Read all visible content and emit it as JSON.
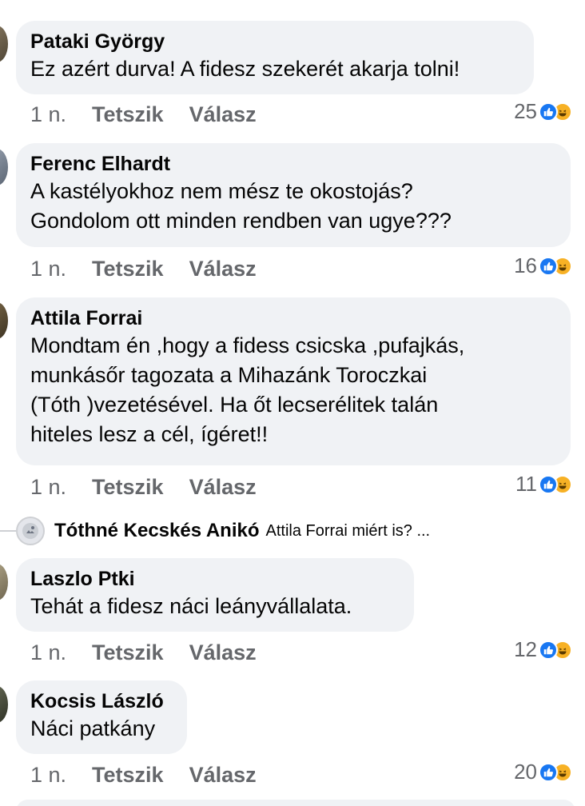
{
  "comments": [
    {
      "author": "Pataki György",
      "text": [
        "Ez azért durva! A fidesz szekerét akarja tolni!"
      ],
      "time": "1 n.",
      "like_label": "Tetszik",
      "reply_label": "Válasz",
      "reaction_count": "25",
      "reactions": [
        "like-icon",
        "haha-icon"
      ]
    },
    {
      "author": "Ferenc Elhardt",
      "text": [
        "A kastélyokhoz nem mész te okostojás?",
        "Gondolom ott minden rendben van ugye???"
      ],
      "time": "1 n.",
      "like_label": "Tetszik",
      "reply_label": "Válasz",
      "reaction_count": "16",
      "reactions": [
        "like-icon",
        "haha-icon"
      ]
    },
    {
      "author": "Attila Forrai",
      "text": [
        "Mondtam én ,hogy a fidess csicska ,pufajkás,",
        "munkásőr tagozata a Mihazánk Toroczkai",
        "(Tóth )vezetésével. Ha őt lecserélitek talán",
        "hiteles lesz a cél, ígéret!!"
      ],
      "time": "1 n.",
      "like_label": "Tetszik",
      "reply_label": "Válasz",
      "reaction_count": "11",
      "reactions": [
        "like-icon",
        "haha-icon"
      ],
      "reply_preview": {
        "author": "Tóthné Kecskés Anikó",
        "snippet": "Attila Forrai  miért is? ..."
      }
    },
    {
      "author": "Laszlo Ptki",
      "text": [
        "Tehát a fidesz náci leányvállalata."
      ],
      "time": "1 n.",
      "like_label": "Tetszik",
      "reply_label": "Válasz",
      "reaction_count": "12",
      "reactions": [
        "like-icon",
        "haha-icon"
      ]
    },
    {
      "author": "Kocsis László",
      "text": [
        "Náci patkány"
      ],
      "time": "1 n.",
      "like_label": "Tetszik",
      "reply_label": "Válasz",
      "reaction_count": "20",
      "reactions": [
        "like-icon",
        "haha-icon"
      ]
    }
  ],
  "colors": {
    "bubble_bg": "#f0f2f5",
    "secondary_text": "#65676b",
    "like_blue": "#1877f2",
    "haha_yellow": "#f7b125"
  }
}
